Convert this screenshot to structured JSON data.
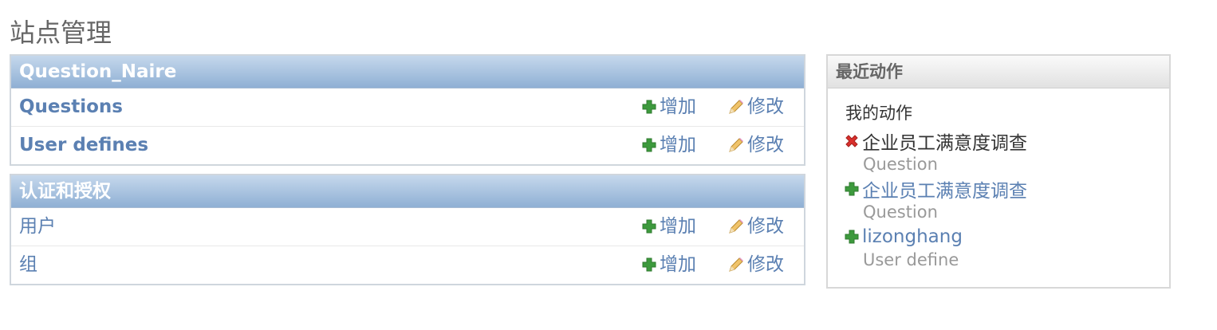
{
  "page": {
    "title": "站点管理"
  },
  "apps": [
    {
      "caption": "Question_Naire",
      "models": [
        {
          "name": "Questions",
          "add_label": "增加",
          "change_label": "修改"
        },
        {
          "name": "User defines",
          "add_label": "增加",
          "change_label": "修改"
        }
      ]
    },
    {
      "caption": "认证和授权",
      "models": [
        {
          "name": "用户",
          "add_label": "增加",
          "change_label": "修改"
        },
        {
          "name": "组",
          "add_label": "增加",
          "change_label": "修改"
        }
      ]
    }
  ],
  "recent_actions": {
    "caption": "最近动作",
    "subtitle": "我的动作",
    "items": [
      {
        "action": "delete",
        "object": "企业员工满意度调查",
        "type": "Question"
      },
      {
        "action": "add",
        "object": "企业员工满意度调查",
        "type": "Question"
      },
      {
        "action": "add",
        "object": "lizonghang",
        "type": "User define"
      }
    ]
  },
  "colors": {
    "link": "#5b80b2",
    "caption_bg": "#8fb0d4",
    "add_icon": "#3d9a3d",
    "delete_icon": "#d9302c"
  },
  "icons": {
    "add": "plus-icon",
    "change": "pencil-icon",
    "delete": "x-icon"
  }
}
